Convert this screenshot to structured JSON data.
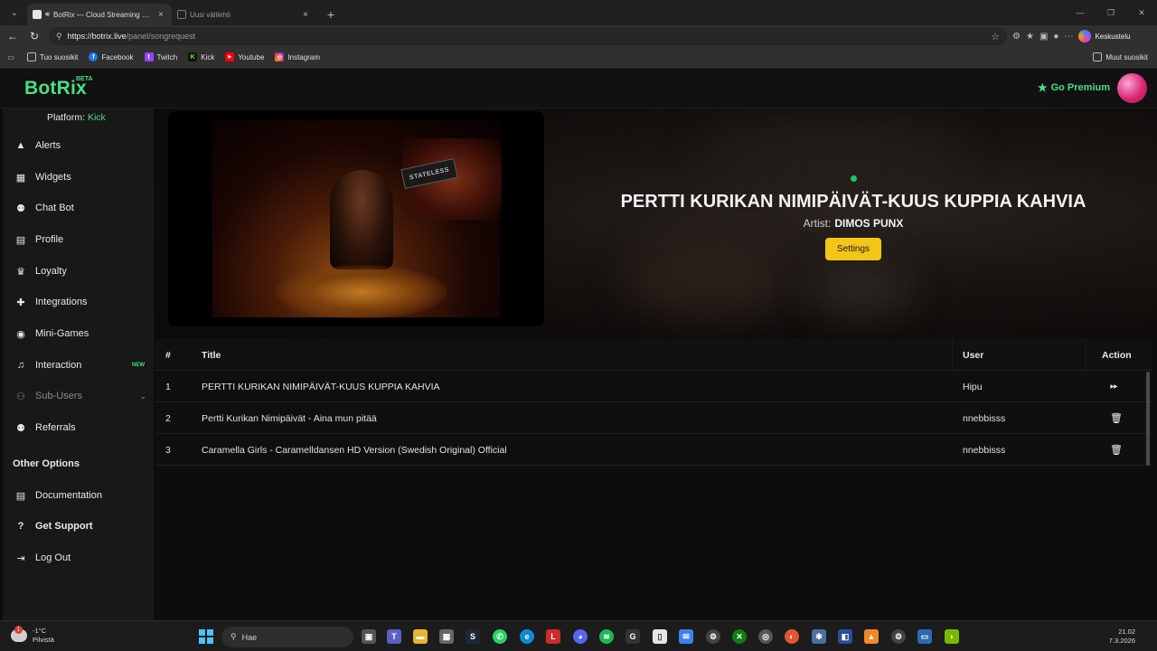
{
  "browser": {
    "tabs": [
      {
        "title": "BotRix — Cloud Streaming Bot",
        "active": true
      },
      {
        "title": "Uusi välilehti",
        "active": false
      }
    ],
    "url_host": "https://botrix.live",
    "url_path": "/panel/songrequest",
    "copilot_label": "Keskustelu",
    "bookmarks": [
      "Tuo suosikit",
      "Facebook",
      "Twitch",
      "Kick",
      "Youtube",
      "Instagram"
    ],
    "bookmarks_other": "Muut suosikit"
  },
  "app": {
    "logo": "BotRix",
    "logo_badge": "BETA",
    "premium_label": "Go Premium",
    "accent": "#4ade80"
  },
  "sidebar": {
    "platform_label": "Platform:",
    "platform_value": "Kick",
    "items": [
      {
        "label": "Alerts",
        "icon": "warning-icon"
      },
      {
        "label": "Widgets",
        "icon": "grid-icon"
      },
      {
        "label": "Chat Bot",
        "icon": "robot-icon"
      },
      {
        "label": "Profile",
        "icon": "id-card-icon"
      },
      {
        "label": "Loyalty",
        "icon": "trophy-icon"
      },
      {
        "label": "Integrations",
        "icon": "puzzle-icon"
      },
      {
        "label": "Mini-Games",
        "icon": "gamepad-icon"
      },
      {
        "label": "Interaction",
        "icon": "music-note-icon",
        "badge": "NEW"
      },
      {
        "label": "Sub-Users",
        "icon": "users-icon"
      },
      {
        "label": "Referrals",
        "icon": "people-icon"
      }
    ],
    "other_options_title": "Other Options",
    "other_items": [
      {
        "label": "Documentation",
        "icon": "book-icon"
      },
      {
        "label": "Get Support",
        "icon": "question-icon"
      },
      {
        "label": "Log Out",
        "icon": "logout-icon"
      }
    ]
  },
  "now_playing": {
    "title": "PERTTI KURIKAN NIMIPÄIVÄT-KUUS KUPPIA KAHVIA",
    "artist_label": "Artist:",
    "artist": "DIMOS PUNX",
    "settings_label": "Settings",
    "video_sign_text": "STATELESS"
  },
  "queue": {
    "headers": {
      "num": "#",
      "title": "Title",
      "user": "User",
      "action": "Action"
    },
    "rows": [
      {
        "num": "1",
        "title": "PERTTI KURIKAN NIMIPÄIVÄT-KUUS KUPPIA KAHVIA",
        "user": "Hipu",
        "action": "skip-icon"
      },
      {
        "num": "2",
        "title": "Pertti Kurikan Nimipäivät - Aina mun pitää",
        "user": "nnebbisss",
        "action": "trash-icon"
      },
      {
        "num": "3",
        "title": "Caramella Girls - Caramelldansen HD Version (Swedish Original) Official",
        "user": "nnebbisss",
        "action": "trash-icon"
      }
    ]
  },
  "taskbar": {
    "weather_temp": "-1°C",
    "weather_desc": "Pilvistä",
    "weather_alert": "1",
    "search_placeholder": "Hae",
    "time": "21.02",
    "date": "7.3.2026"
  }
}
